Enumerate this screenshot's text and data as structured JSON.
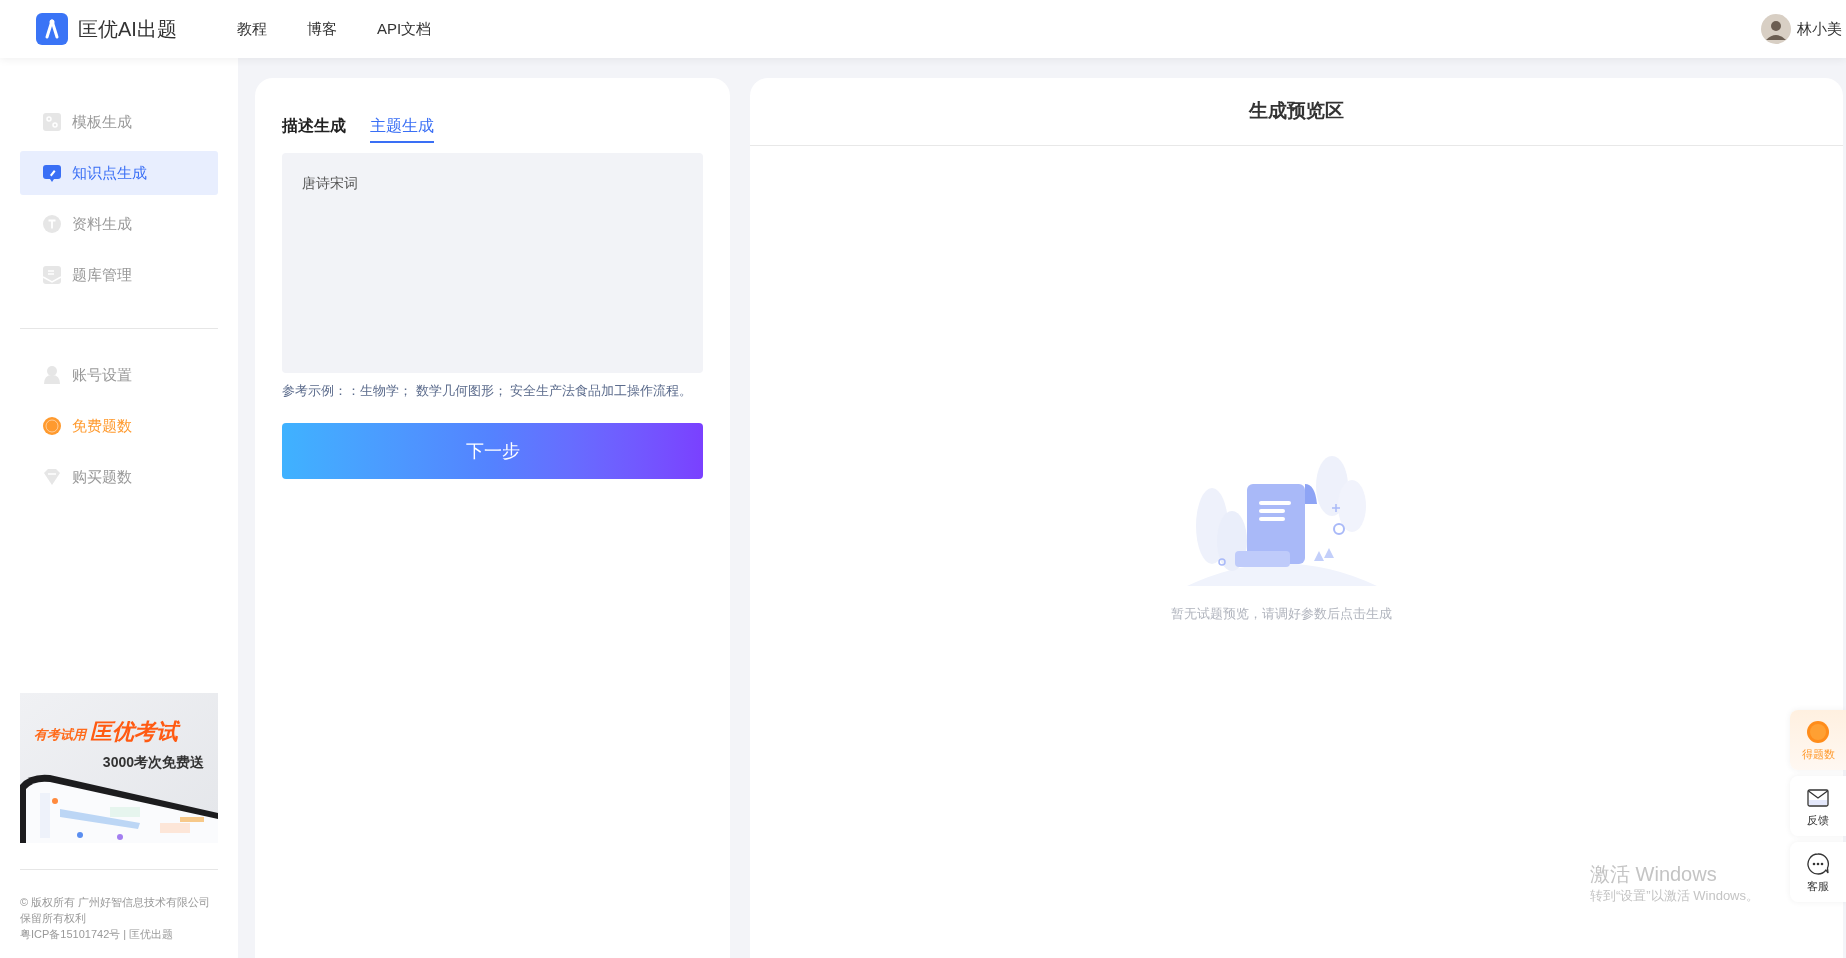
{
  "header": {
    "brand": "匡优AI出题",
    "nav": [
      {
        "label": "教程"
      },
      {
        "label": "博客"
      },
      {
        "label": "API文档"
      }
    ],
    "user": {
      "name": "林小美"
    }
  },
  "sidebar": {
    "groups": [
      [
        {
          "label": "模板生成",
          "selected": false,
          "accent": false
        },
        {
          "label": "知识点生成",
          "selected": true,
          "accent": false
        },
        {
          "label": "资料生成",
          "selected": false,
          "accent": false
        },
        {
          "label": "题库管理",
          "selected": false,
          "accent": false
        }
      ],
      [
        {
          "label": "账号设置",
          "selected": false,
          "accent": false
        },
        {
          "label": "免费题数",
          "selected": false,
          "accent": true
        },
        {
          "label": "购买题数",
          "selected": false,
          "accent": false
        }
      ]
    ],
    "banner": {
      "tagline": "有考试用",
      "headline": "匡优考试",
      "offer": "3000考次免费送"
    },
    "footer": [
      "© 版权所有 广州好智信息技术有限公司",
      "保留所有权利",
      "粤ICP备15101742号 | 匡优出题"
    ]
  },
  "form": {
    "tabs": [
      {
        "label": "描述生成",
        "selected": false
      },
      {
        "label": "主题生成",
        "selected": true
      }
    ],
    "topic": {
      "value": "唐诗宋词"
    },
    "hint": "参考示例：：生物学；  数学几何图形；  安全生产法食品加工操作流程。",
    "button": "下一步"
  },
  "preview": {
    "title": "生成预览区",
    "empty_text": "暂无试题预览，请调好参数后点击生成"
  },
  "float_buttons": [
    {
      "label": "得题数",
      "accent": true
    },
    {
      "label": "反馈",
      "accent": false
    },
    {
      "label": "客服",
      "accent": false
    }
  ],
  "os_notice": {
    "title": "激活 Windows",
    "text": "转到“设置”以激活 Windows。"
  }
}
